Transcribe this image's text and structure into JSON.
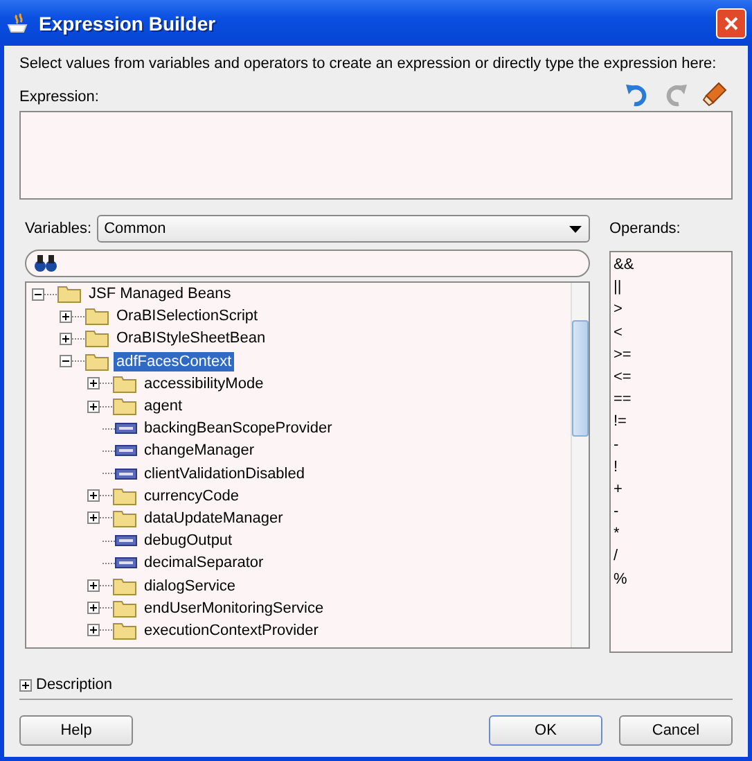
{
  "window": {
    "title": "Expression Builder"
  },
  "instructions": "Select values from variables and operators to create an expression or directly type the expression here:",
  "expression": {
    "label": "Expression:"
  },
  "variables": {
    "label": "Variables:",
    "value": "Common"
  },
  "tree": [
    {
      "label": "JSF Managed Beans",
      "kind": "folder",
      "expanded": true,
      "selected": false,
      "children": [
        {
          "label": "OraBISelectionScript",
          "kind": "folder",
          "expanded": false,
          "selected": false
        },
        {
          "label": "OraBIStyleSheetBean",
          "kind": "folder",
          "expanded": false,
          "selected": false
        },
        {
          "label": "adfFacesContext",
          "kind": "folder",
          "expanded": true,
          "selected": true,
          "children": [
            {
              "label": "accessibilityMode",
              "kind": "folder",
              "expanded": false,
              "selected": false
            },
            {
              "label": "agent",
              "kind": "folder",
              "expanded": false,
              "selected": false
            },
            {
              "label": "backingBeanScopeProvider",
              "kind": "property",
              "selected": false
            },
            {
              "label": "changeManager",
              "kind": "property",
              "selected": false
            },
            {
              "label": "clientValidationDisabled",
              "kind": "property",
              "selected": false
            },
            {
              "label": "currencyCode",
              "kind": "folder",
              "expanded": false,
              "selected": false
            },
            {
              "label": "dataUpdateManager",
              "kind": "folder",
              "expanded": false,
              "selected": false
            },
            {
              "label": "debugOutput",
              "kind": "property",
              "selected": false
            },
            {
              "label": "decimalSeparator",
              "kind": "property",
              "selected": false
            },
            {
              "label": "dialogService",
              "kind": "folder",
              "expanded": false,
              "selected": false
            },
            {
              "label": "endUserMonitoringService",
              "kind": "folder",
              "expanded": false,
              "selected": false
            },
            {
              "label": "executionContextProvider",
              "kind": "folder",
              "expanded": false,
              "selected": false
            }
          ]
        }
      ]
    }
  ],
  "operands": {
    "label": "Operands:",
    "items": [
      "&&",
      "||",
      ">",
      "<",
      ">=",
      "<=",
      "==",
      "!=",
      "-",
      "!",
      "+",
      "-",
      "*",
      "/",
      "%"
    ]
  },
  "description": {
    "label": "Description",
    "expanded": false
  },
  "buttons": {
    "help": "Help",
    "ok": "OK",
    "cancel": "Cancel"
  }
}
